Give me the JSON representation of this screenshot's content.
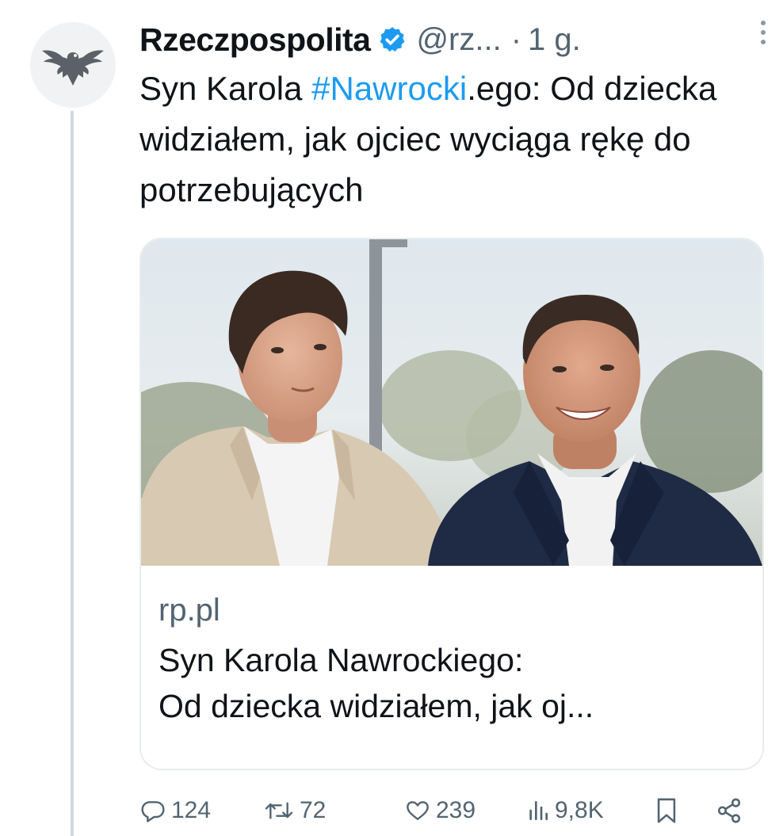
{
  "account": {
    "name": "Rzeczpospolita",
    "handle": "@rz...",
    "separator": "·",
    "time": "1 g."
  },
  "tweet": {
    "text_prefix": "Syn Karola ",
    "hashtag": "#Nawrocki",
    "text_rest": ".ego: Od dziecka widziałem, jak ojciec wyciąga rękę do potrzebujących"
  },
  "card": {
    "domain": "rp.pl",
    "title_line1": "Syn Karola Nawrockiego:",
    "title_line2": "Od dziecka widziałem, jak oj..."
  },
  "actions": {
    "replies": "124",
    "reposts": "72",
    "likes": "239",
    "views": "9,8K"
  },
  "colors": {
    "accent": "#1d9bf0",
    "text": "#0f1419",
    "secondary": "#536471",
    "thread_line": "#cfd9de"
  },
  "icons": [
    "eagle-logo-icon",
    "verified-badge-icon",
    "more-icon",
    "reply-icon",
    "repost-icon",
    "like-icon",
    "views-icon",
    "bookmark-icon",
    "share-icon"
  ]
}
